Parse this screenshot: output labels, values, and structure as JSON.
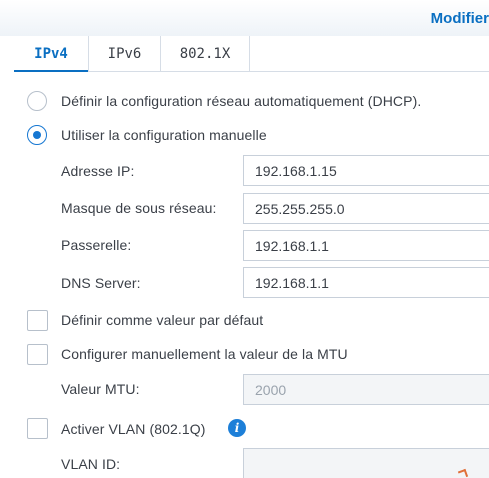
{
  "window": {
    "title": "Modifier"
  },
  "tabs": [
    {
      "label": "IPv4",
      "active": true
    },
    {
      "label": "IPv6",
      "active": false
    },
    {
      "label": "802.1X",
      "active": false
    }
  ],
  "ipv4": {
    "dhcp_option": {
      "label": "Définir la configuration réseau automatiquement (DHCP).",
      "selected": false
    },
    "manual_option": {
      "label": "Utiliser la configuration manuelle",
      "selected": true
    },
    "fields": {
      "ip": {
        "label": "Adresse IP:",
        "value": "192.168.1.15"
      },
      "mask": {
        "label": "Masque de sous réseau:",
        "value": "255.255.255.0"
      },
      "gateway": {
        "label": "Passerelle:",
        "value": "192.168.1.1"
      },
      "dns": {
        "label": "DNS Server:",
        "value": "192.168.1.1"
      }
    },
    "default_checkbox": {
      "label": "Définir comme valeur par défaut",
      "checked": false
    },
    "mtu_checkbox": {
      "label": "Configurer manuellement la valeur de la MTU",
      "checked": false
    },
    "mtu_field": {
      "label": "Valeur MTU:",
      "value": "2000"
    },
    "vlan_checkbox": {
      "label": "Activer VLAN (802.1Q)",
      "checked": false
    },
    "vlan_field": {
      "label": "VLAN ID:",
      "value": ""
    }
  },
  "icons": {
    "info": "info-icon"
  },
  "colors": {
    "accent": "#0a6fc2",
    "radio_selected": "#1677d2",
    "info": "#1d7fd8"
  }
}
